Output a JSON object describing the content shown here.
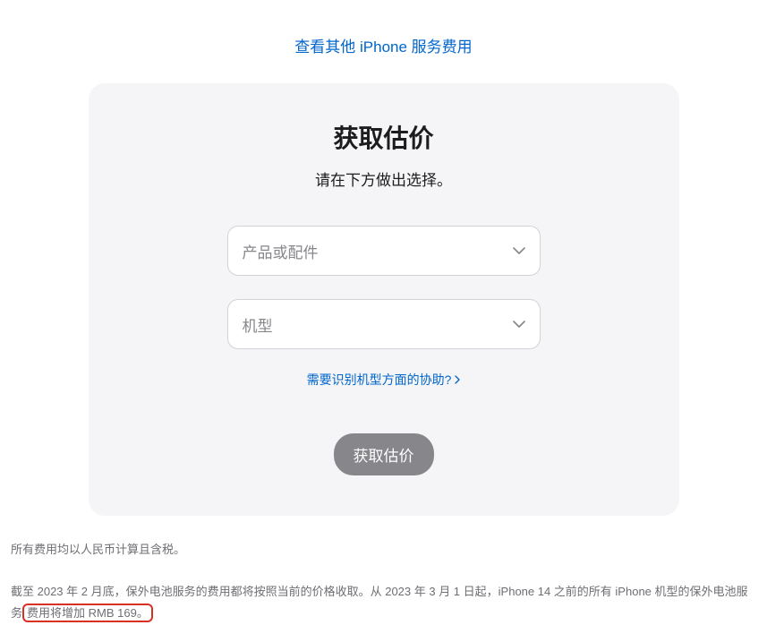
{
  "topLink": {
    "label": "查看其他 iPhone 服务费用"
  },
  "card": {
    "title": "获取估价",
    "subtitle": "请在下方做出选择。",
    "select1": {
      "placeholder": "产品或配件"
    },
    "select2": {
      "placeholder": "机型"
    },
    "helpLink": "需要识别机型方面的协助?",
    "button": "获取估价"
  },
  "footnotes": {
    "line1": "所有费用均以人民币计算且含税。",
    "line2_prefix": "截至 2023 年 2 月底，保外电池服务的费用都将按照当前的价格收取。从 2023 年 3 月 1 日起，iPhone 14 之前的所有 iPhone 机型的保外电池服务",
    "line2_highlight": "费用将增加 RMB 169。"
  }
}
